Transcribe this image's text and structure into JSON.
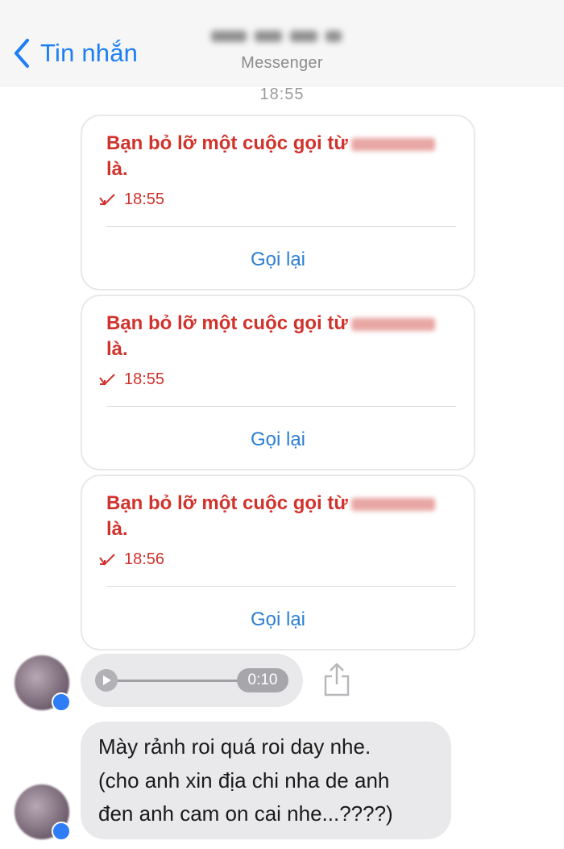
{
  "header": {
    "back_label": "Tin nhắn",
    "subtitle": "Messenger"
  },
  "timestamp": "18:55",
  "missed_calls": [
    {
      "line1": "Bạn bỏ lỡ một cuộc gọi từ",
      "line2": "là.",
      "time": "18:55",
      "action": "Gọi lại"
    },
    {
      "line1": "Bạn bỏ lỡ một cuộc gọi từ",
      "line2": "là.",
      "time": "18:55",
      "action": "Gọi lại"
    },
    {
      "line1": "Bạn bỏ lỡ một cuộc gọi từ",
      "line2": "là.",
      "time": "18:56",
      "action": "Gọi lại"
    }
  ],
  "voice_message": {
    "duration": "0:10"
  },
  "text_message": {
    "lines": [
      "Mày rảnh roi quá roi day nhe.",
      "(cho anh xin địa chi nha de anh",
      "đen anh cam on cai nhe...????)"
    ]
  },
  "colors": {
    "accent": "#1e7ff5",
    "missed_call_red": "#d0322c",
    "action_blue": "#2c7fd2",
    "bubble_gray": "#e9e9eb"
  },
  "icons": {
    "back": "chevron-left-icon",
    "missed": "missed-call-arrow-icon",
    "play": "play-icon",
    "share": "share-icon"
  }
}
